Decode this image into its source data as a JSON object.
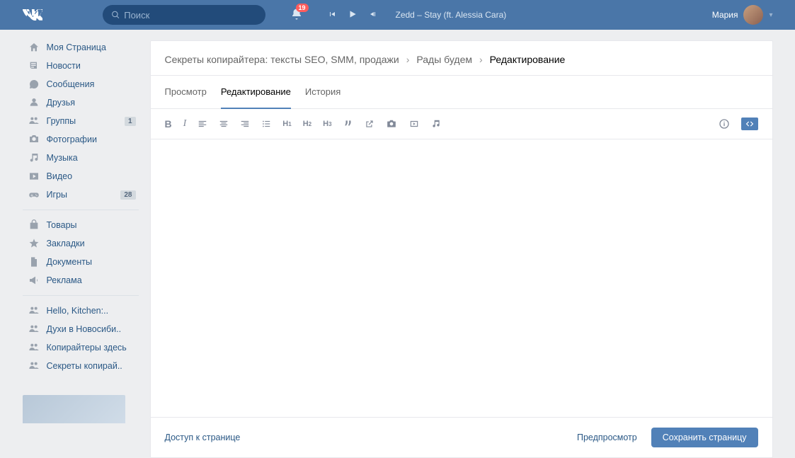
{
  "header": {
    "search_placeholder": "Поиск",
    "notif_count": "19",
    "track": "Zedd – Stay (ft. Alessia Cara)",
    "user_name": "Мария"
  },
  "sidebar": {
    "items": [
      {
        "label": "Моя Страница",
        "icon": "home"
      },
      {
        "label": "Новости",
        "icon": "news"
      },
      {
        "label": "Сообщения",
        "icon": "msg"
      },
      {
        "label": "Друзья",
        "icon": "user"
      },
      {
        "label": "Группы",
        "icon": "users",
        "badge": "1"
      },
      {
        "label": "Фотографии",
        "icon": "camera"
      },
      {
        "label": "Музыка",
        "icon": "music"
      },
      {
        "label": "Видео",
        "icon": "video"
      },
      {
        "label": "Игры",
        "icon": "game",
        "badge": "28"
      }
    ],
    "items2": [
      {
        "label": "Товары",
        "icon": "bag"
      },
      {
        "label": "Закладки",
        "icon": "star"
      },
      {
        "label": "Документы",
        "icon": "doc"
      },
      {
        "label": "Реклама",
        "icon": "ads"
      }
    ],
    "items3": [
      {
        "label": "Hello, Kitchen:..",
        "icon": "users"
      },
      {
        "label": "Духи в Новосиби..",
        "icon": "users"
      },
      {
        "label": "Копирайтеры здесь",
        "icon": "users"
      },
      {
        "label": "Секреты копирай..",
        "icon": "users"
      }
    ]
  },
  "breadcrumb": {
    "root": "Секреты копирайтера: тексты SEO, SMM, продажи",
    "mid": "Рады будем",
    "current": "Редактирование"
  },
  "tabs": {
    "preview": "Просмотр",
    "edit": "Редактирование",
    "history": "История"
  },
  "footer": {
    "access": "Доступ к странице",
    "preview": "Предпросмотр",
    "save": "Сохранить страницу"
  }
}
